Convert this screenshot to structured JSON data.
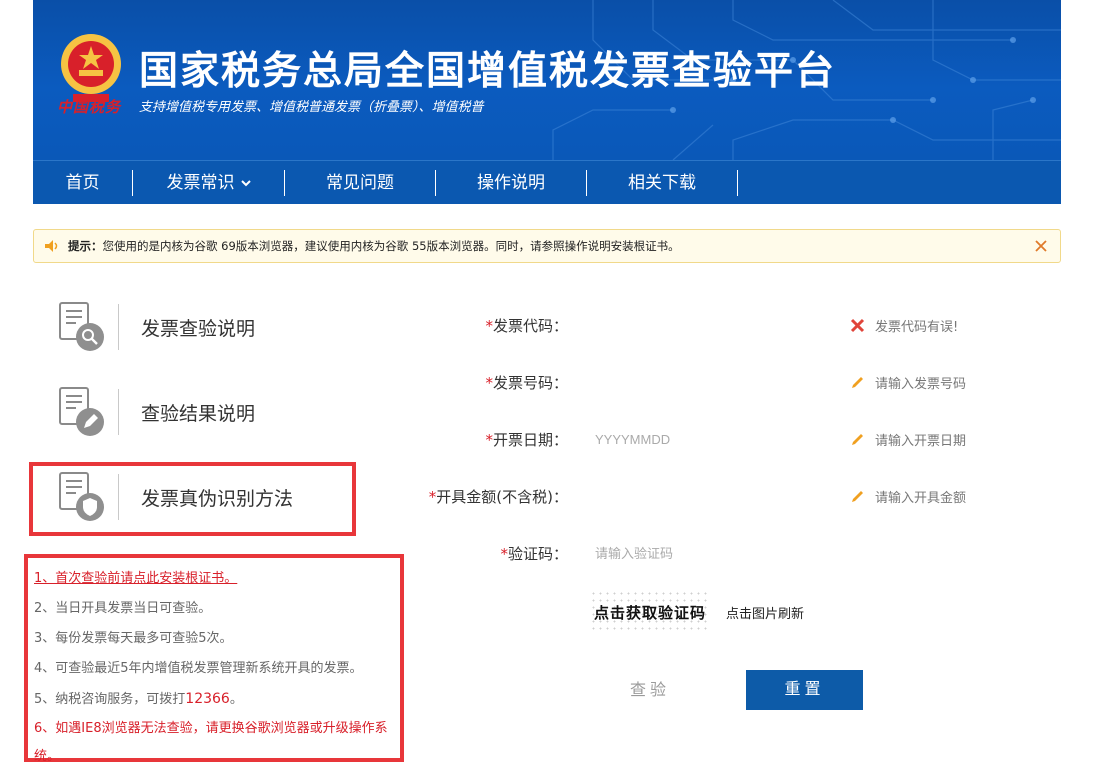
{
  "header": {
    "title": "国家税务总局全国增值税发票查验平台",
    "subtitle": "支持增值税专用发票、增值税普通发票（折叠票）、增值税普",
    "brand_text": "中国税务",
    "banner_color": "#0b5bbf",
    "logo_icon": "national-emblem-icon"
  },
  "nav": {
    "items": [
      {
        "label": "首页"
      },
      {
        "label": "发票常识",
        "has_dropdown": true
      },
      {
        "label": "常见问题"
      },
      {
        "label": "操作说明"
      },
      {
        "label": "相关下载"
      }
    ]
  },
  "notice": {
    "prefix": "提示：",
    "text": "您使用的是内核为谷歌 69版本浏览器，建议使用内核为谷歌 55版本浏览器。同时，请参照操作说明安装根证书。",
    "icon": "speaker-icon",
    "close_icon": "close-icon"
  },
  "side_links": [
    {
      "label": "发票查验说明",
      "icon": "document-search-icon"
    },
    {
      "label": "查验结果说明",
      "icon": "document-edit-icon"
    },
    {
      "label": "发票真伪识别方法",
      "icon": "document-shield-icon"
    }
  ],
  "tips": [
    "1、首次查验前请点此安装根证书。",
    "2、当日开具发票当日可查验。",
    "3、每份发票每天最多可查验5次。",
    "4、可查验最近5年内增值税发票管理新系统开具的发票。",
    "5、纳税咨询服务，可拨打",
    "12366",
    "。",
    "6、如遇IE8浏览器无法查验，请更换谷歌浏览器或升级操作系统。"
  ],
  "form": {
    "required_mark": "*",
    "fields": [
      {
        "label": "发票代码：",
        "value": "",
        "placeholder": "",
        "hint": "发票代码有误!",
        "hint_icon": "error-x-icon"
      },
      {
        "label": "发票号码：",
        "value": "",
        "placeholder": "",
        "hint": "请输入发票号码",
        "hint_icon": "pencil-icon"
      },
      {
        "label": "开票日期：",
        "value": "",
        "placeholder": "YYYYMMDD",
        "hint": "请输入开票日期",
        "hint_icon": "pencil-icon"
      },
      {
        "label": "开具金额(不含税)：",
        "value": "",
        "placeholder": "",
        "hint": "请输入开具金额",
        "hint_icon": "pencil-icon"
      },
      {
        "label": "验证码：",
        "value": "",
        "placeholder": "请输入验证码"
      }
    ],
    "captcha_text": "点击获取验证码",
    "refresh_text": "点击图片刷新",
    "check_button": "查验",
    "reset_button": "重置",
    "accent_color": "#0d5ba8",
    "error_color": "#d8202a"
  }
}
